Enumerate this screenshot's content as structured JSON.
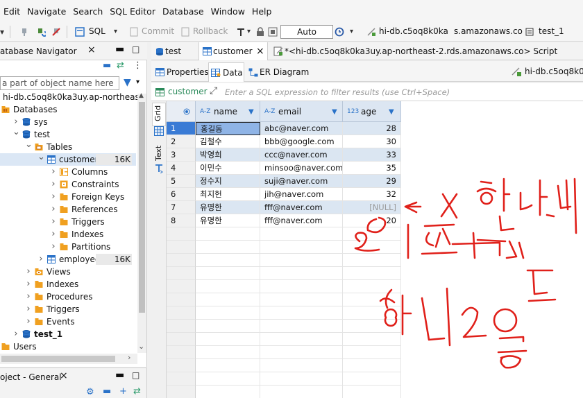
{
  "menu": [
    "Edit",
    "Navigate",
    "Search",
    "SQL Editor",
    "Database",
    "Window",
    "Help"
  ],
  "toolbar": {
    "sql_label": "SQL",
    "commit_label": "Commit",
    "rollback_label": "Rollback",
    "transaction_mode": "Auto",
    "connection_label": "hi-db.c5oq8k0ka",
    "connection_host": "s.amazonaws.co",
    "schema_label": "test_1"
  },
  "navigator": {
    "title": "atabase Navigator",
    "filter_placeholder": "a part of object name here",
    "tree": [
      {
        "label": "hi-db.c5oq8k0ka3uy.ap-northeast-2",
        "level": 0,
        "arrow": "",
        "icon": "connection"
      },
      {
        "label": "Databases",
        "level": 0,
        "arrow": "",
        "icon": "databases"
      },
      {
        "label": "sys",
        "level": 1,
        "arrow": ">",
        "icon": "db"
      },
      {
        "label": "test",
        "level": 1,
        "arrow": "v",
        "icon": "db"
      },
      {
        "label": "Tables",
        "level": 2,
        "arrow": "v",
        "icon": "tables"
      },
      {
        "label": "customer",
        "level": 3,
        "arrow": "v",
        "icon": "table",
        "badge": "16K",
        "selected": true
      },
      {
        "label": "Columns",
        "level": 4,
        "arrow": ">",
        "icon": "columns"
      },
      {
        "label": "Constraints",
        "level": 4,
        "arrow": ">",
        "icon": "constraints"
      },
      {
        "label": "Foreign Keys",
        "level": 4,
        "arrow": ">",
        "icon": "folder"
      },
      {
        "label": "References",
        "level": 4,
        "arrow": ">",
        "icon": "folder"
      },
      {
        "label": "Triggers",
        "level": 4,
        "arrow": ">",
        "icon": "folder"
      },
      {
        "label": "Indexes",
        "level": 4,
        "arrow": ">",
        "icon": "folder"
      },
      {
        "label": "Partitions",
        "level": 4,
        "arrow": ">",
        "icon": "folder"
      },
      {
        "label": "employee",
        "level": 3,
        "arrow": ">",
        "icon": "table",
        "badge": "16K"
      },
      {
        "label": "Views",
        "level": 2,
        "arrow": ">",
        "icon": "views"
      },
      {
        "label": "Indexes",
        "level": 2,
        "arrow": ">",
        "icon": "folder"
      },
      {
        "label": "Procedures",
        "level": 2,
        "arrow": ">",
        "icon": "folder"
      },
      {
        "label": "Triggers",
        "level": 2,
        "arrow": ">",
        "icon": "folder"
      },
      {
        "label": "Events",
        "level": 2,
        "arrow": ">",
        "icon": "folder"
      },
      {
        "label": "test_1",
        "level": 1,
        "arrow": ">",
        "icon": "db",
        "bold": true
      },
      {
        "label": "Users",
        "level": 0,
        "arrow": ">",
        "icon": "users"
      }
    ]
  },
  "project_panel": {
    "title": "oject - General"
  },
  "editor_tabs": [
    {
      "label": "test",
      "active": false
    },
    {
      "label": "customer",
      "active": true
    },
    {
      "label": "*<hi-db.c5oq8k0ka3uy.ap-northeast-2.rds.amazonaws.co> Script",
      "active": false
    }
  ],
  "sub_tabs": [
    {
      "label": "Properties",
      "active": false
    },
    {
      "label": "Data",
      "active": true
    },
    {
      "label": "ER Diagram",
      "active": false
    }
  ],
  "connection_right": "hi-db.c5oq8k0k",
  "filter": {
    "table_label": "customer",
    "placeholder": "Enter a SQL expression to filter results (use Ctrl+Space)"
  },
  "vertical_tabs": {
    "grid": "Grid",
    "text": "Text"
  },
  "grid": {
    "columns": [
      {
        "name": "name",
        "type": "A-Z"
      },
      {
        "name": "email",
        "type": "A-Z"
      },
      {
        "name": "age",
        "type": "123"
      }
    ],
    "rows": [
      {
        "n": "1",
        "name": "홍길동",
        "email": "abc@naver.com",
        "age": "28"
      },
      {
        "n": "2",
        "name": "김철수",
        "email": "bbb@google.com",
        "age": "30"
      },
      {
        "n": "3",
        "name": "박영희",
        "email": "ccc@naver.com",
        "age": "33"
      },
      {
        "n": "4",
        "name": "이민수",
        "email": "minsoo@naver.com",
        "age": "35"
      },
      {
        "n": "5",
        "name": "정수지",
        "email": "suji@naver.com",
        "age": "29"
      },
      {
        "n": "6",
        "name": "최지헌",
        "email": "jih@naver.com",
        "age": "32"
      },
      {
        "n": "7",
        "name": "유명한",
        "email": "fff@naver.com",
        "age": "[NULL]"
      },
      {
        "n": "8",
        "name": "유명한",
        "email": "fff@naver.com",
        "age": "20"
      }
    ]
  },
  "annotation": {
    "color": "#e0201a",
    "line1": "<- X 했는데",
    "line2": "디폴트체크",
    "line3": "하니 20뜸"
  }
}
